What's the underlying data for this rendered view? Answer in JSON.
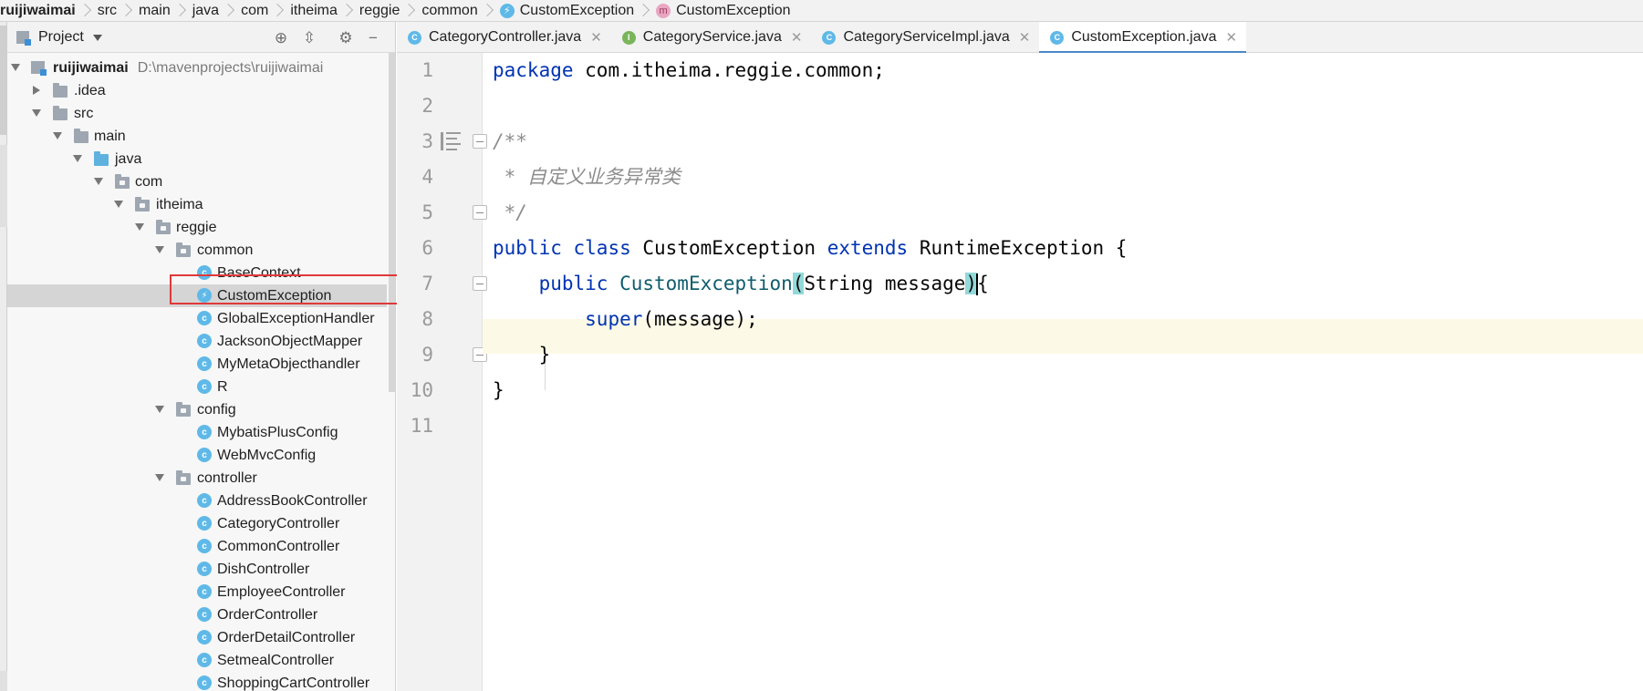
{
  "breadcrumb": {
    "items": [
      "ruijiwaimai",
      "src",
      "main",
      "java",
      "com",
      "itheima",
      "reggie",
      "common",
      "CustomException",
      "CustomException"
    ]
  },
  "project_panel": {
    "title": "Project",
    "root_name": "ruijiwaimai",
    "root_path": "D:\\mavenprojects\\ruijiwaimai",
    "tree": [
      ".idea",
      "src",
      "main",
      "java",
      "com",
      "itheima",
      "reggie",
      "common",
      "BaseContext",
      "CustomException",
      "GlobalExceptionHandler",
      "JacksonObjectMapper",
      "MyMetaObjecthandler",
      "R",
      "config",
      "MybatisPlusConfig",
      "WebMvcConfig",
      "controller",
      "AddressBookController",
      "CategoryController",
      "CommonController",
      "DishController",
      "EmployeeController",
      "OrderController",
      "OrderDetailController",
      "SetmealController",
      "ShoppingCartController"
    ]
  },
  "tabs": [
    {
      "label": "CategoryController.java",
      "icon": "C",
      "color": "#5fb9e8"
    },
    {
      "label": "CategoryService.java",
      "icon": "I",
      "color": "#7ab55c"
    },
    {
      "label": "CategoryServiceImpl.java",
      "icon": "C",
      "color": "#5fb9e8"
    },
    {
      "label": "CustomException.java",
      "icon": "C",
      "color": "#5fb9e8"
    }
  ],
  "editor": {
    "line_numbers": [
      "1",
      "2",
      "3",
      "4",
      "5",
      "6",
      "7",
      "8",
      "9",
      "10",
      "11"
    ],
    "code": {
      "l1_kw": "package",
      "l1_rest": " com.itheima.reggie.common;",
      "l3": "/**",
      "l4": " * 自定义业务异常类",
      "l5": " */",
      "l6_kw1": "public",
      "l6_kw2": "class",
      "l6_name": "CustomException",
      "l6_kw3": "extends",
      "l6_rest": "RuntimeException {",
      "l7_kw": "public",
      "l7_name": "CustomException",
      "l7_open": "(",
      "l7_params": "String message",
      "l7_close": ")",
      "l7_brace": "{",
      "l8_kw": "super",
      "l8_rest": "(message);",
      "l9": "}",
      "l10": "}"
    }
  },
  "colors": {
    "keyword": "#0033b3",
    "class_name": "#0f5c6e",
    "comment": "#8c8c8c",
    "highlight_box": "#e0393a",
    "active_tab_underline": "#4a88c7"
  }
}
